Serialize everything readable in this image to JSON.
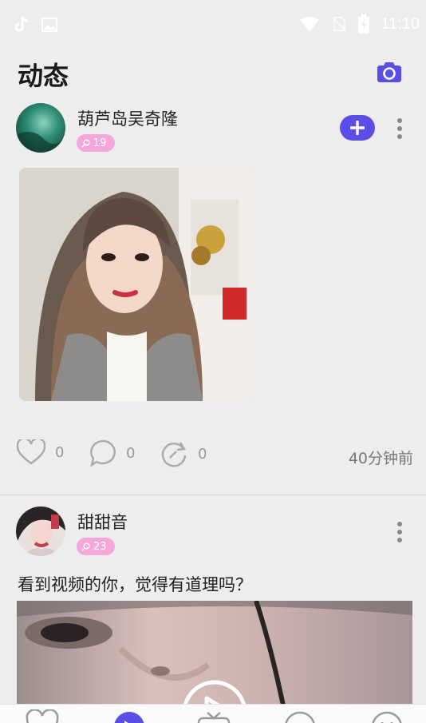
{
  "status_bar": {
    "time": "11:10",
    "left_icons": [
      "tiktok-icon",
      "image-icon"
    ],
    "right_icons": [
      "wifi-icon",
      "no-sim-icon",
      "battery-charging-icon"
    ]
  },
  "header": {
    "title": "动态",
    "camera_icon": "camera-icon"
  },
  "posts": [
    {
      "username": "葫芦岛吴奇隆",
      "badge_value": "19",
      "actions": {
        "likes": "0",
        "comments": "0",
        "shares": "0"
      },
      "time_ago": "40分钟前"
    },
    {
      "username": "甜甜音",
      "badge_value": "23",
      "text": "看到视频的你，觉得有道理吗？"
    }
  ],
  "tab_bar": {
    "icons": [
      "heart-tab-icon",
      "dynamic-tab-icon",
      "tv-tab-icon",
      "message-tab-icon",
      "profile-tab-icon"
    ]
  },
  "colors": {
    "accent": "#5b4de8",
    "badge": "#f5a7dc",
    "background": "#ededed"
  }
}
